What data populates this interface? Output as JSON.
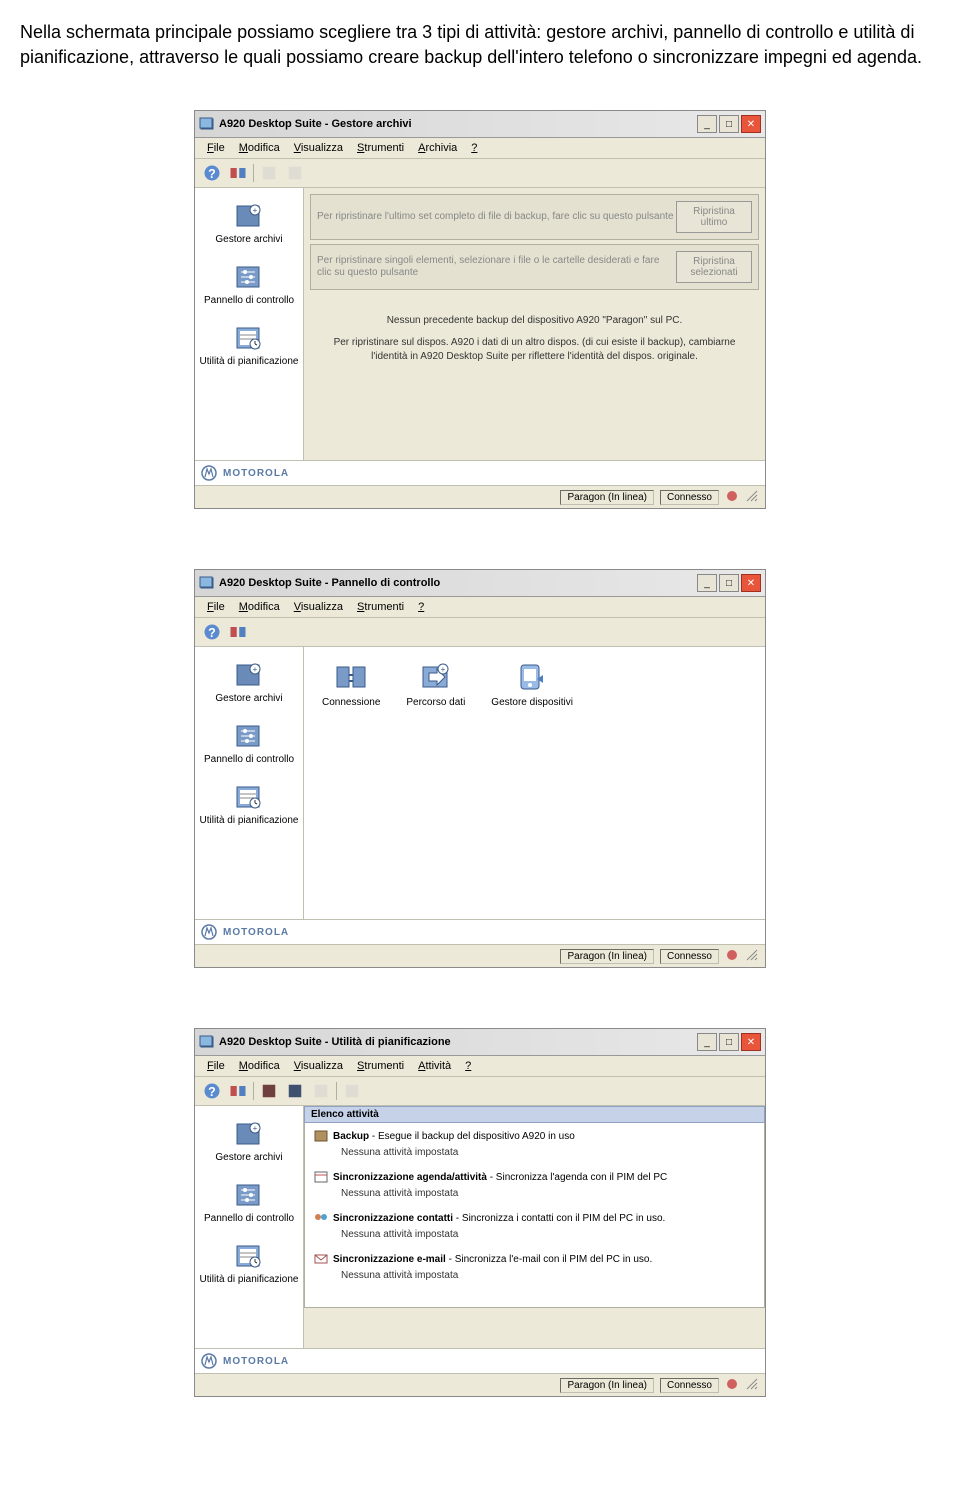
{
  "intro": "Nella schermata principale possiamo scegliere tra 3 tipi di attività: gestore archivi, pannello di controllo e utilità di pianificazione, attraverso le quali possiamo creare backup dell'intero telefono o sincronizzare impegni ed agenda.",
  "brand": "MOTOROLA",
  "status": [
    "Paragon (In linea)",
    "Connesso"
  ],
  "sidebar": {
    "items": [
      {
        "label": "Gestore archivi"
      },
      {
        "label": "Pannello di controllo"
      },
      {
        "label": "Utilità di pianificazione"
      }
    ]
  },
  "win1": {
    "title": "A920 Desktop Suite - Gestore archivi",
    "menus": [
      {
        "u": "F",
        "rest": "ile"
      },
      {
        "u": "M",
        "rest": "odifica"
      },
      {
        "u": "V",
        "rest": "isualizza"
      },
      {
        "u": "S",
        "rest": "trumenti"
      },
      {
        "u": "A",
        "rest": "rchivia"
      },
      {
        "u": "?",
        "rest": ""
      }
    ],
    "restore1_text": "Per ripristinare l'ultimo set completo di file di backup, fare clic su questo pulsante",
    "restore1_btn": "Ripristina ultimo",
    "restore2_text": "Per ripristinare singoli elementi, selezionare i file o le cartelle desiderati e fare clic su questo pulsante",
    "restore2_btn": "Ripristina selezionati",
    "msg1": "Nessun precedente backup del dispositivo A920 \"Paragon\" sul PC.",
    "msg2": "Per ripristinare sul dispos. A920 i dati di un altro dispos. (di cui esiste il backup), cambiarne l'identità in A920 Desktop Suite per riflettere l'identità del dispos. originale."
  },
  "win2": {
    "title": "A920 Desktop Suite - Pannello di controllo",
    "menus": [
      {
        "u": "F",
        "rest": "ile"
      },
      {
        "u": "M",
        "rest": "odifica"
      },
      {
        "u": "V",
        "rest": "isualizza"
      },
      {
        "u": "S",
        "rest": "trumenti"
      },
      {
        "u": "?",
        "rest": ""
      }
    ],
    "icons": [
      {
        "label": "Connessione"
      },
      {
        "label": "Percorso dati"
      },
      {
        "label": "Gestore dispositivi"
      }
    ]
  },
  "win3": {
    "title": "A920 Desktop Suite - Utilità di pianificazione",
    "menus": [
      {
        "u": "F",
        "rest": "ile"
      },
      {
        "u": "M",
        "rest": "odifica"
      },
      {
        "u": "V",
        "rest": "isualizza"
      },
      {
        "u": "S",
        "rest": "trumenti"
      },
      {
        "u": "A",
        "rest": "ttività"
      },
      {
        "u": "?",
        "rest": ""
      }
    ],
    "header": "Elenco attività",
    "none": "Nessuna attività impostata",
    "activities": [
      {
        "bold": "Backup",
        "desc": " - Esegue il backup del dispositivo A920 in uso"
      },
      {
        "bold": "Sincronizzazione agenda/attività",
        "desc": " - Sincronizza l'agenda con il PIM del PC"
      },
      {
        "bold": "Sincronizzazione contatti",
        "desc": " - Sincronizza i contatti con il PIM del PC in uso."
      },
      {
        "bold": "Sincronizzazione e-mail",
        "desc": " - Sincronizza l'e-mail con il PIM del PC in uso."
      }
    ]
  }
}
